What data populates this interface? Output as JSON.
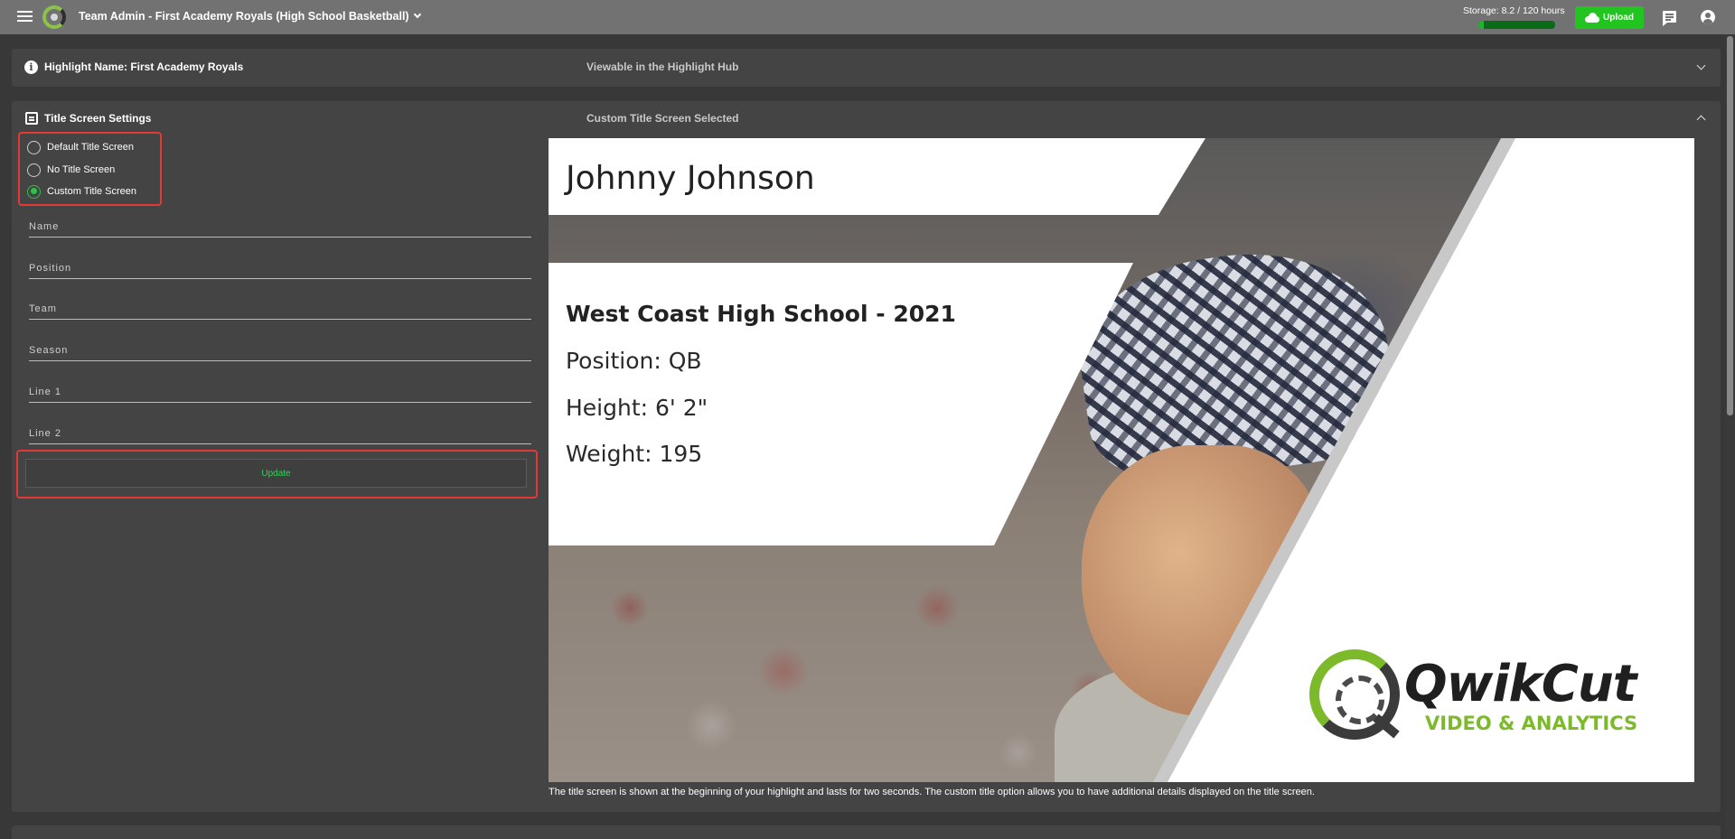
{
  "topbar": {
    "title": "Team Admin - First Academy Royals (High School Basketball)",
    "storage_label": "Storage: 8.2 / 120 hours",
    "storage_used_fraction": 0.068,
    "upload_label": "Upload",
    "icons": [
      "menu-icon",
      "app-logo",
      "chevron-down-icon",
      "cloud-upload-icon",
      "chat-icon",
      "account-icon"
    ]
  },
  "highlight_panel": {
    "title": "Highlight Name: First Academy Royals",
    "subtitle": "Viewable in the Highlight Hub"
  },
  "title_screen_panel": {
    "title": "Title Screen Settings",
    "subtitle": "Custom Title Screen Selected",
    "options": [
      {
        "label": "Default Title Screen",
        "selected": false
      },
      {
        "label": "No Title Screen",
        "selected": false
      },
      {
        "label": "Custom Title Screen",
        "selected": true
      }
    ],
    "fields": [
      {
        "placeholder": "Name",
        "value": ""
      },
      {
        "placeholder": "Position",
        "value": ""
      },
      {
        "placeholder": "Team",
        "value": ""
      },
      {
        "placeholder": "Season",
        "value": ""
      },
      {
        "placeholder": "Line 1",
        "value": ""
      },
      {
        "placeholder": "Line 2",
        "value": ""
      }
    ],
    "update_label": "Update"
  },
  "preview": {
    "name": "Johnny Johnson",
    "school": "West Coast High School - 2021",
    "line1": "Position: QB",
    "line2": "Height: 6' 2\"",
    "line3": "Weight: 195",
    "brand": "QwikCut",
    "brand_sub": "VIDEO & ANALYTICS"
  },
  "caption": "The title screen is shown at the beginning of your highlight and lasts for two seconds. The custom title option allows you to have additional details displayed on the title screen.",
  "colors": {
    "accent_green": "#22c51f",
    "highlight_red": "#e53935",
    "radio_green": "#2fc24a",
    "brand_green": "#7cba2c"
  }
}
